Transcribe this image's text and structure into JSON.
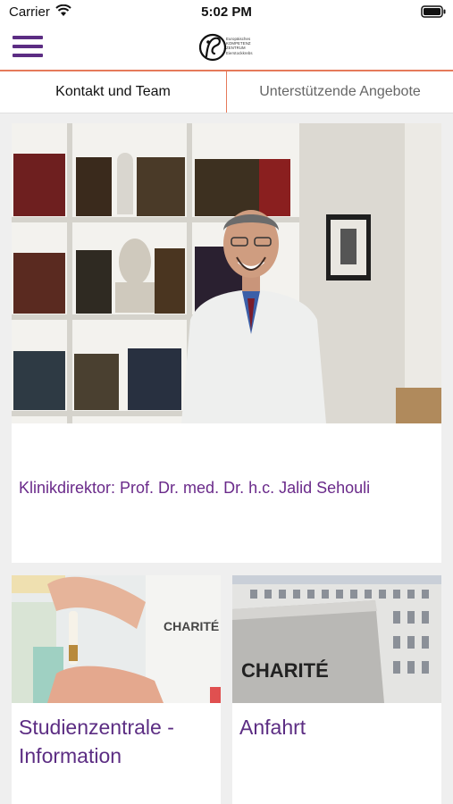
{
  "status_bar": {
    "carrier": "Carrier",
    "time": "5:02 PM"
  },
  "header": {
    "menu_icon": "hamburger-menu-icon",
    "logo_lines": [
      "Europäisches",
      "KOMPETENZ",
      "ZENTRUM",
      "Eierstockkrebs"
    ]
  },
  "tabs": [
    {
      "label": "Kontakt und Team",
      "active": true
    },
    {
      "label": "Unterstützende Angebote",
      "active": false
    }
  ],
  "main_card": {
    "caption": "Klinikdirektor: Prof. Dr. med. Dr. h.c. Jalid Sehouli"
  },
  "cards": [
    {
      "title": "Studienzentrale - Information",
      "photo_text": "CHARITÉ"
    },
    {
      "title": "Anfahrt",
      "photo_text": "CHARITÉ"
    }
  ],
  "colors": {
    "accent_purple": "#5c2d83",
    "divider_orange": "#e57a5a"
  }
}
